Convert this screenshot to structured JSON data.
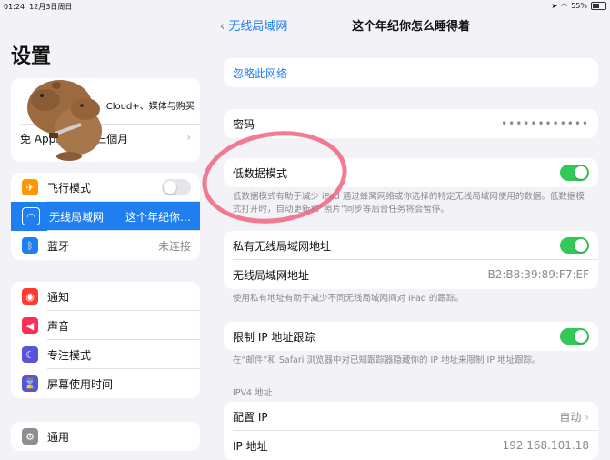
{
  "status": {
    "time": "01:24",
    "date": "12月3日周日",
    "battery": "55%"
  },
  "sidebar": {
    "title": "设置",
    "profile": {
      "line1": "iCloud+、媒体与购买",
      "line2_prefix": "免",
      "line2": "Apple TV+ 三個月"
    },
    "connectivity": [
      {
        "icon": "airplane-icon",
        "label": "飞行模式",
        "value": "",
        "color": "#ff9500"
      },
      {
        "icon": "wifi-icon",
        "label": "无线局域网",
        "value": "这个年纪你…",
        "color": "#1f7ef0"
      },
      {
        "icon": "bluetooth-icon",
        "label": "蓝牙",
        "value": "未连接",
        "color": "#1f7ef0"
      }
    ],
    "notifications": [
      {
        "icon": "notification-icon",
        "label": "通知",
        "color": "#ff3b30"
      },
      {
        "icon": "sound-icon",
        "label": "声音",
        "color": "#ff2d55"
      },
      {
        "icon": "moon-icon",
        "label": "专注模式",
        "color": "#5856d6"
      },
      {
        "icon": "hourglass-icon",
        "label": "屏幕使用时间",
        "color": "#5856d6"
      }
    ],
    "general": [
      {
        "icon": "gear-icon",
        "label": "通用",
        "color": "#8e8e93"
      }
    ]
  },
  "detail": {
    "back_label": "无线局域网",
    "title": "这个年纪你怎么睡得着",
    "forget": "忽略此网络",
    "password_label": "密码",
    "password_value": "••••••••••••",
    "low_data_label": "低数据模式",
    "low_data_note": "低数据模式有助于减少 iPad 通过蜂窝网络或你选择的特定无线局域网使用的数据。低数据模式打开时，自动更新和“照片”同步等后台任务将会暂停。",
    "private_addr_label": "私有无线局域网地址",
    "wifi_addr_label": "无线局域网地址",
    "wifi_addr_value": "B2:B8:39:89:F7:EF",
    "private_note": "使用私有地址有助于减少不同无线局域网间对 iPad 的跟踪。",
    "limit_ip_label": "限制 IP 地址跟踪",
    "limit_ip_note": "在“邮件”和 Safari 浏览器中对已知跟踪器隐藏你的 IP 地址来限制 IP 地址跟踪。",
    "ipv4_header": "IPV4 地址",
    "config_ip_label": "配置 IP",
    "config_ip_value": "自动",
    "ip_label": "IP 地址",
    "ip_value": "192.168.101.18"
  }
}
